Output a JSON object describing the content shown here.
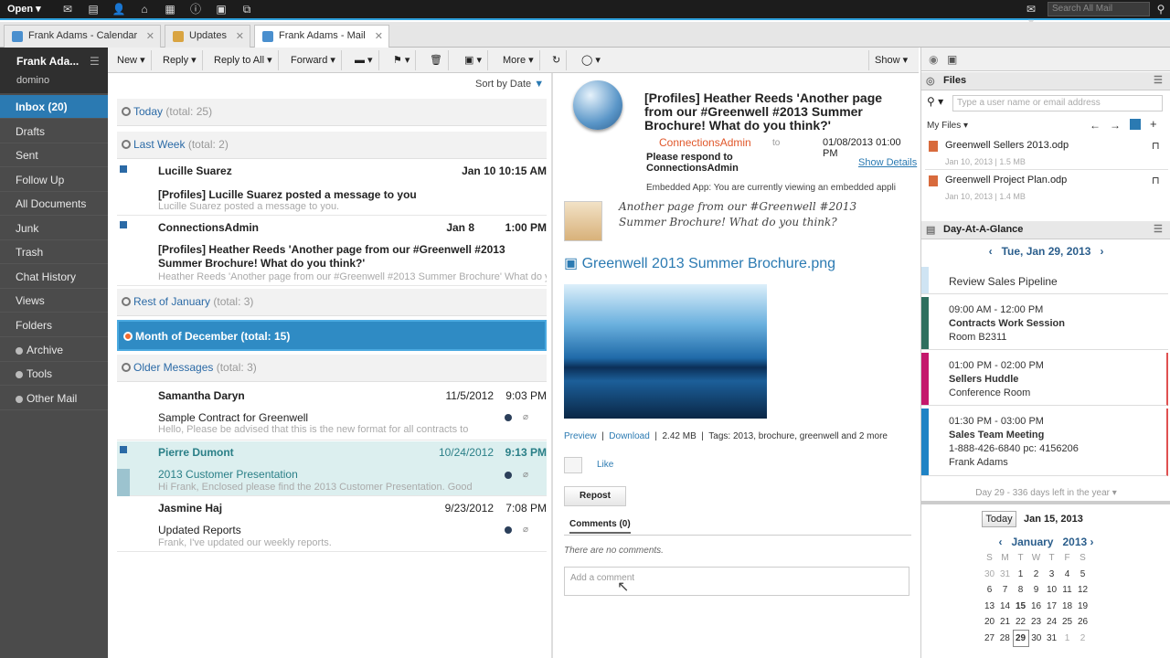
{
  "topbar": {
    "open_label": "Open",
    "search_placeholder": "Search All Mail"
  },
  "tabs": [
    {
      "label": "Frank Adams - Calendar"
    },
    {
      "label": "Updates"
    },
    {
      "label": "Frank Adams - Mail"
    }
  ],
  "sidebar": {
    "user_name": "Frank Ada...",
    "user_sub": "domino",
    "items": [
      {
        "label": "Inbox (20)"
      },
      {
        "label": "Drafts"
      },
      {
        "label": "Sent"
      },
      {
        "label": "Follow Up"
      },
      {
        "label": "All Documents"
      },
      {
        "label": "Junk"
      },
      {
        "label": "Trash"
      },
      {
        "label": "Chat History"
      },
      {
        "label": "Views"
      },
      {
        "label": "Folders"
      },
      {
        "label": "Archive"
      },
      {
        "label": "Tools"
      },
      {
        "label": "Other Mail"
      }
    ]
  },
  "toolbar": {
    "new": "New",
    "reply": "Reply",
    "reply_all": "Reply to All",
    "forward": "Forward",
    "more": "More",
    "show": "Show",
    "sort": "Sort by Date"
  },
  "mail": {
    "groups": [
      {
        "label": "Today",
        "total": "(total: 25)"
      },
      {
        "label": "Last Week",
        "total": "(total: 2)"
      },
      {
        "label": "Rest of January",
        "total": "(total: 3)"
      },
      {
        "label": "Month of December (total: 15)"
      },
      {
        "label": "Older Messages",
        "total": "(total: 3)"
      }
    ],
    "messages": [
      {
        "from": "Lucille Suarez",
        "date": "Jan 10 10:15 AM",
        "subject": "[Profiles] Lucille Suarez posted a message to you",
        "preview": "Lucille Suarez posted a message to you."
      },
      {
        "from": "ConnectionsAdmin",
        "date": "Jan 8",
        "time": "1:00 PM",
        "subject": "[Profiles] Heather Reeds 'Another page from our #Greenwell #2013",
        "subject2": "Summer Brochure! What do you think?'",
        "preview": "Heather Reeds 'Another page from our #Greenwell #2013 Summer Brochure' What do you"
      },
      {
        "from": "Samantha Daryn",
        "date": "11/5/2012",
        "time": "9:03 PM",
        "subject": "Sample Contract for Greenwell",
        "preview": "Hello,  Please be advised that this is the new format for all contracts to"
      },
      {
        "from": "Pierre Dumont",
        "date": "10/24/2012",
        "time": "9:13 PM",
        "subject": "2013 Customer Presentation",
        "preview": "Hi Frank, Enclosed please find the 2013 Customer Presentation. Good"
      },
      {
        "from": "Jasmine Haj",
        "date": "9/23/2012",
        "time": "7:08 PM",
        "subject": "Updated Reports",
        "preview": "Frank, I've updated our weekly reports."
      }
    ]
  },
  "reading": {
    "title": "[Profiles] Heather Reeds 'Another page from our #Greenwell #2013 Summer Brochure! What do you think?'",
    "sender": "ConnectionsAdmin",
    "to": "to",
    "datetime": "01/08/2013 01:00 PM",
    "respond": "Please respond to ConnectionsAdmin",
    "show_details": "Show Details",
    "embedded": "Embedded App: You are currently viewing an embedded appli",
    "post_text": "Another page from our #Greenwell #2013 Summer Brochure! What do you think?",
    "file_link": "Greenwell 2013 Summer Brochure.png",
    "preview": "Preview",
    "download": "Download",
    "size": "2.42 MB",
    "tags": "Tags: 2013, brochure, greenwell and 2 more",
    "like": "Like",
    "repost": "Repost",
    "comments_tab": "Comments (0)",
    "no_comments": "There are no comments.",
    "add_comment": "Add a comment"
  },
  "files": {
    "title": "Files",
    "search_placeholder": "Type a user name or email address",
    "my_files": "My Files",
    "items": [
      {
        "name": "Greenwell Sellers 2013.odp",
        "meta": "Jan 10, 2013 | 1.5 MB"
      },
      {
        "name": "Greenwell Project Plan.odp",
        "meta": "Jan 10, 2013 | 1.4 MB"
      }
    ]
  },
  "glance": {
    "title": "Day-At-A-Glance",
    "date": "Tue, Jan 29, 2013",
    "events": [
      {
        "time": "",
        "title": "Review Sales Pipeline",
        "loc": "",
        "color": "#cfe4f3"
      },
      {
        "time": "09:00 AM - 12:00 PM",
        "title": "Contracts Work Session",
        "loc": "Room B2311",
        "color": "#2f6f5e"
      },
      {
        "time": "01:00 PM - 02:00 PM",
        "title": "Sellers Huddle",
        "loc": "Conference Room",
        "color": "#c4186c"
      },
      {
        "time": "01:30 PM - 03:00 PM",
        "title": "Sales Team Meeting",
        "loc": "1-888-426-6840 pc: 4156206",
        "loc2": "Frank Adams",
        "color": "#1f83c5"
      }
    ],
    "footer": "Day 29 - 336 days left in the year"
  },
  "minical": {
    "today_btn": "Today",
    "today_date": "Jan 15, 2013",
    "month": "January",
    "year": "2013",
    "dow": [
      "S",
      "M",
      "T",
      "W",
      "T",
      "F",
      "S"
    ],
    "weeks": [
      [
        "30",
        "31",
        "1",
        "2",
        "3",
        "4",
        "5"
      ],
      [
        "6",
        "7",
        "8",
        "9",
        "10",
        "11",
        "12"
      ],
      [
        "13",
        "14",
        "15",
        "16",
        "17",
        "18",
        "19"
      ],
      [
        "20",
        "21",
        "22",
        "23",
        "24",
        "25",
        "26"
      ],
      [
        "27",
        "28",
        "29",
        "30",
        "31",
        "1",
        "2"
      ]
    ]
  },
  "colors": {
    "accent": "#2b7ab2",
    "selected_group": "#2f8bc4",
    "link": "#2b6aa6",
    "sender": "#e0572a"
  }
}
